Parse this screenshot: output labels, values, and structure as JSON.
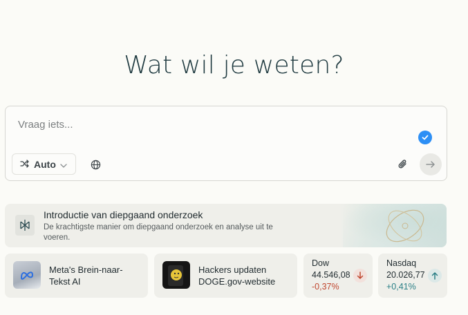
{
  "headline": "Wat wil je weten?",
  "ask": {
    "placeholder": "Vraag iets...",
    "mode_label": "Auto",
    "icons": [
      "shuffle-icon",
      "chevron-down-icon",
      "globe-icon",
      "paperclip-icon",
      "arrow-right-icon",
      "check-icon"
    ]
  },
  "promo": {
    "title": "Introductie van diepgaand onderzoek",
    "description": "De krachtigste manier om diepgaand onderzoek en analyse uit te voeren."
  },
  "news": [
    {
      "title": "Meta's Brein-naar-Tekst AI"
    },
    {
      "title": "Hackers updaten DOGE.gov-website"
    }
  ],
  "stocks": [
    {
      "name": "Dow",
      "value": "44.546,08",
      "change": "-0,37%",
      "direction": "down",
      "color": "#c0472f"
    },
    {
      "name": "Nasdaq",
      "value": "20.026,77",
      "change": "+0,41%",
      "direction": "up",
      "color": "#2a7f86"
    }
  ],
  "colors": {
    "accent": "#2d8ff5",
    "headline": "#1f3a40",
    "down": "#c0472f",
    "up": "#2a7f86"
  }
}
